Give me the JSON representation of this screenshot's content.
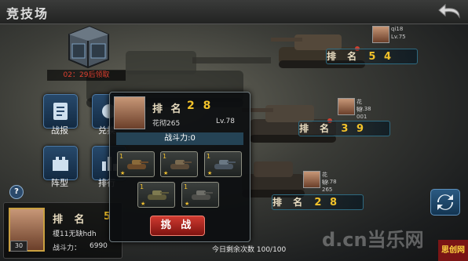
{
  "header": {
    "title": "竞技场"
  },
  "crate": {
    "timer": "02：29后领取"
  },
  "left_menu": {
    "battle_report": "战报",
    "exchange": "兑换",
    "formation": "阵型",
    "ranking": "排行"
  },
  "opponents": [
    {
      "name": "qi18",
      "level": "Lv.75",
      "rank_label": "排 名",
      "rank": "5 4"
    },
    {
      "name": "花彻001",
      "level": "Lv.38",
      "rank_label": "排 名",
      "rank": "3 9"
    },
    {
      "name": "花彻265",
      "level": "Lv.78",
      "rank_label": "排 名",
      "rank": "2 8"
    }
  ],
  "popup": {
    "rank_label": "排 名",
    "rank": "2 8",
    "name": "花彻265",
    "level": "Lv.78",
    "power": "战斗力:0",
    "slots": [
      {
        "num": "1"
      },
      {
        "num": "1"
      },
      {
        "num": "1"
      },
      {
        "num": "1"
      },
      {
        "num": "1"
      }
    ],
    "challenge_label": "挑 战"
  },
  "player": {
    "level": "30",
    "rank_label": "排 名",
    "rank": "5",
    "name": "榎11无缺hdh",
    "power_label": "战斗力：",
    "power": "6990"
  },
  "footer": {
    "remaining": "今日剩余次数 100/100"
  },
  "help": {
    "label": "?"
  },
  "watermark": {
    "text": "d.cn当乐网"
  },
  "corner": {
    "text": "思创网"
  },
  "colors": {
    "rank_gold": "#f2c22a",
    "challenge_red": "#c0302a",
    "accent_blue": "#2b5a82"
  }
}
